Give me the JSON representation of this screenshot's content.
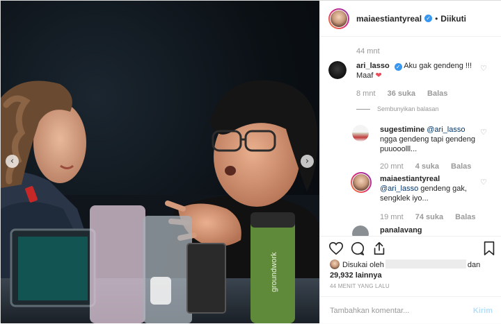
{
  "header": {
    "username": "maiaestiantyreal",
    "verified_icon": "verified-badge-icon",
    "separator": "•",
    "follow_status": "Diikuti"
  },
  "photo": {
    "prev_icon": "chevron-left-icon",
    "next_icon": "chevron-right-icon",
    "prev_glyph": "‹",
    "next_glyph": "›",
    "bottle_text": "groundwork"
  },
  "comments": {
    "top_time": "44 mnt",
    "items": [
      {
        "username": "ari_lasso",
        "text": "Aku gak gendeng !!! Maaf",
        "emoji": "❤",
        "time": "8 mnt",
        "likes": "36 suka",
        "reply": "Balas"
      }
    ],
    "hide_replies": "Sembunyikan balasan",
    "replies": [
      {
        "username": "sugestimine",
        "mention": "@ari_lasso",
        "text": "ngga gendeng tapi gendeng puuooolll...",
        "time": "20 mnt",
        "likes": "4 suka",
        "reply": "Balas"
      },
      {
        "username": "maiaestiantyreal",
        "mention": "@ari_lasso",
        "text": "gendeng gak, sengklek iyo...",
        "time": "19 mnt",
        "likes": "74 suka",
        "reply": "Balas"
      }
    ],
    "partial_username": "panalavang"
  },
  "actions": {
    "like_icon": "heart-icon",
    "comment_icon": "comment-icon",
    "share_icon": "share-icon",
    "save_icon": "bookmark-icon",
    "liked_by_prefix": "Disukai oleh",
    "liked_by_suffix": "dan",
    "likes_count": "29,932 lainnya",
    "time_ago": "44 MENIT YANG LALU",
    "comment_placeholder": "Tambahkan komentar...",
    "post_label": "Kirim"
  },
  "colors": {
    "accent": "#3897f0",
    "heart": "#ed4956",
    "post_disabled": "#b2dffc"
  }
}
